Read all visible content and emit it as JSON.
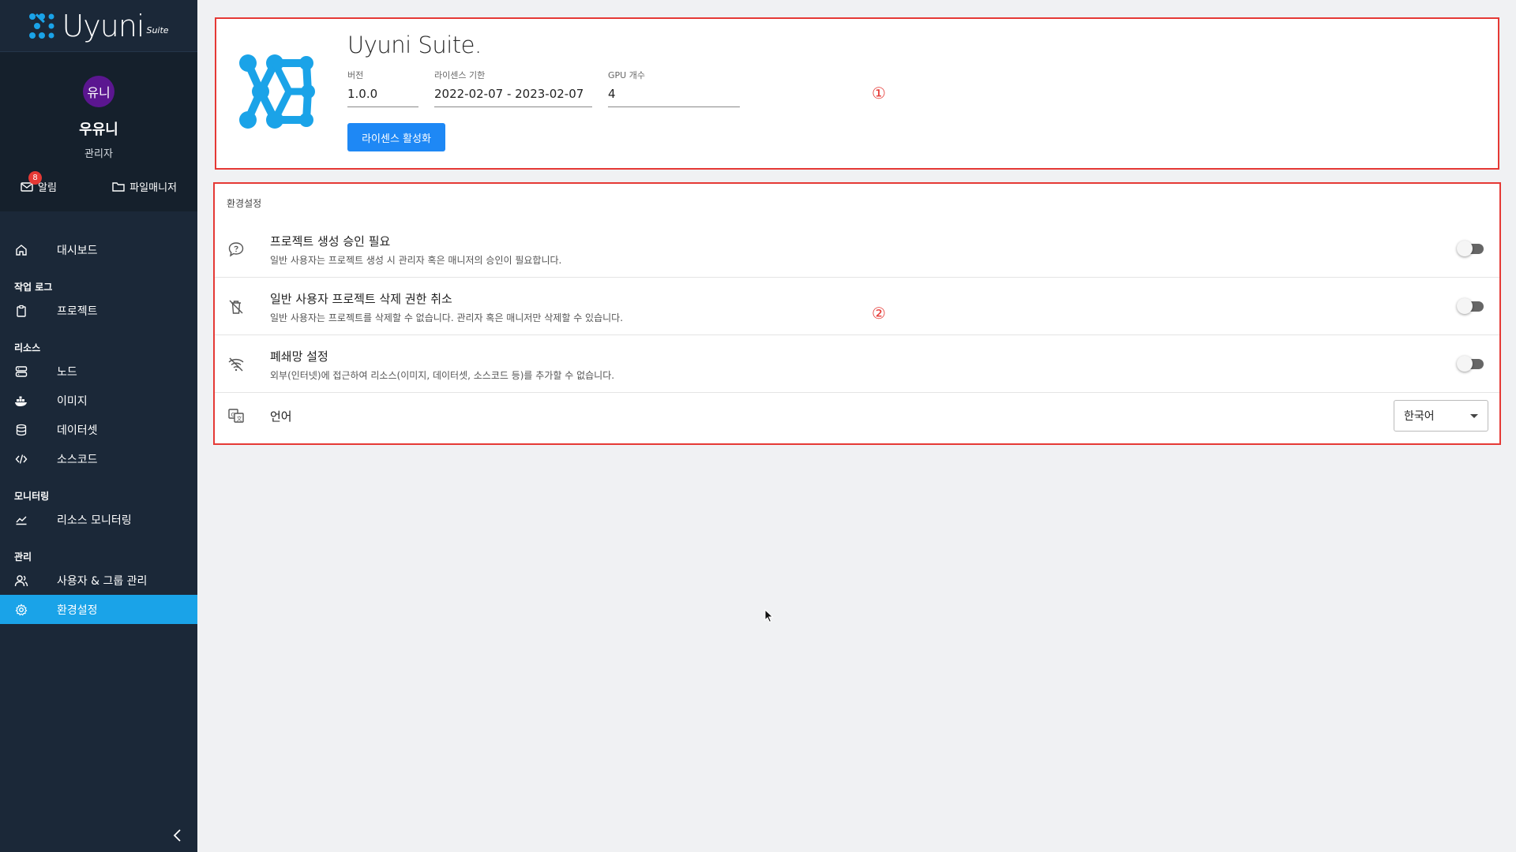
{
  "brand": {
    "name": "Uyuni",
    "suffix": "Suite"
  },
  "profile": {
    "avatar_text": "유니",
    "name": "우유니",
    "role": "관리자",
    "alerts_label": "알림",
    "alerts_count": "8",
    "file_manager_label": "파일매니저"
  },
  "nav": {
    "dashboard": "대시보드",
    "section_worklog": "작업 로그",
    "project": "프로젝트",
    "section_resources": "리소스",
    "node": "노드",
    "image": "이미지",
    "dataset": "데이터셋",
    "sourcecode": "소스코드",
    "section_monitoring": "모니터링",
    "resource_monitoring": "리소스 모니터링",
    "section_admin": "관리",
    "user_group": "사용자 & 그룹 관리",
    "settings": "환경설정"
  },
  "license": {
    "product_title": "Uyuni Suite.",
    "version_label": "버전",
    "version_value": "1.0.0",
    "period_label": "라이센스 기한",
    "period_value": "2022-02-07 - 2023-02-07",
    "gpu_label": "GPU 개수",
    "gpu_value": "4",
    "activate_label": "라이센스 활성화",
    "annotation": "①"
  },
  "settings": {
    "title": "환경설정",
    "annotation": "②",
    "items": [
      {
        "title": "프로젝트 생성 승인 필요",
        "desc": "일반 사용자는 프로젝트 생성 시 관리자 혹은 매니저의 승인이 필요합니다.",
        "enabled": false
      },
      {
        "title": "일반 사용자 프로젝트 삭제 권한 취소",
        "desc": "일반 사용자는 프로젝트를 삭제할 수 없습니다. 관리자 혹은 매니저만 삭제할 수 있습니다.",
        "enabled": false
      },
      {
        "title": "폐쇄망 설정",
        "desc": "외부(인터넷)에 접근하여 리소스(이미지, 데이터셋, 소스코드 등)를 추가할 수 없습니다.",
        "enabled": false
      }
    ],
    "language_label": "언어",
    "language_value": "한국어"
  },
  "colors": {
    "sidebar_bg": "#1b2838",
    "active_nav": "#1aa3e8",
    "primary_button": "#1e88f5",
    "annotation_red": "#e53935",
    "avatar_bg": "#5b1690",
    "logo_blue": "#1aa3e8"
  }
}
